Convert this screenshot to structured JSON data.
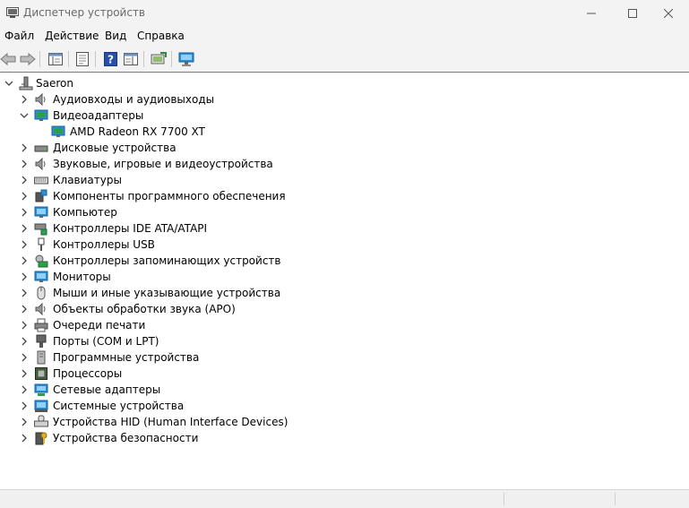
{
  "window": {
    "title": "Диспетчер устройств",
    "controls": [
      "minimize-icon",
      "maximize-icon",
      "close-icon"
    ]
  },
  "menu": {
    "items": [
      "Файл",
      "Действие",
      "Вид",
      "Справка"
    ]
  },
  "toolbar": {
    "buttons": [
      "back-icon",
      "forward-icon",
      "show-hide-tree-icon",
      "properties-icon",
      "help-icon",
      "action-pane-icon",
      "update-driver-icon",
      "scan-hardware-icon"
    ]
  },
  "tree": {
    "root": "Saeron",
    "items": [
      {
        "label": "Аудиовходы и аудиовыходы",
        "expanded": false
      },
      {
        "label": "Видеоадаптеры",
        "expanded": true,
        "children": [
          "AMD Radeon RX 7700 XT"
        ]
      },
      {
        "label": "Дисковые устройства",
        "expanded": false
      },
      {
        "label": "Звуковые, игровые и видеоустройства",
        "expanded": false
      },
      {
        "label": "Клавиатуры",
        "expanded": false
      },
      {
        "label": "Компоненты программного обеспечения",
        "expanded": false
      },
      {
        "label": "Компьютер",
        "expanded": false
      },
      {
        "label": "Контроллеры IDE ATA/ATAPI",
        "expanded": false
      },
      {
        "label": "Контроллеры USB",
        "expanded": false
      },
      {
        "label": "Контроллеры запоминающих устройств",
        "expanded": false
      },
      {
        "label": "Мониторы",
        "expanded": false
      },
      {
        "label": "Мыши и иные указывающие устройства",
        "expanded": false
      },
      {
        "label": "Объекты обработки звука (APO)",
        "expanded": false
      },
      {
        "label": "Очереди печати",
        "expanded": false
      },
      {
        "label": "Порты (COM и LPT)",
        "expanded": false
      },
      {
        "label": "Программные устройства",
        "expanded": false
      },
      {
        "label": "Процессоры",
        "expanded": false
      },
      {
        "label": "Сетевые адаптеры",
        "expanded": false
      },
      {
        "label": "Системные устройства",
        "expanded": false
      },
      {
        "label": "Устройства HID (Human Interface Devices)",
        "expanded": false
      },
      {
        "label": "Устройства безопасности",
        "expanded": false
      }
    ]
  },
  "colors": {
    "chrome": "#f3f3f3",
    "accent_blue": "#1e73be",
    "monitor_blue": "#2b8fd8"
  }
}
